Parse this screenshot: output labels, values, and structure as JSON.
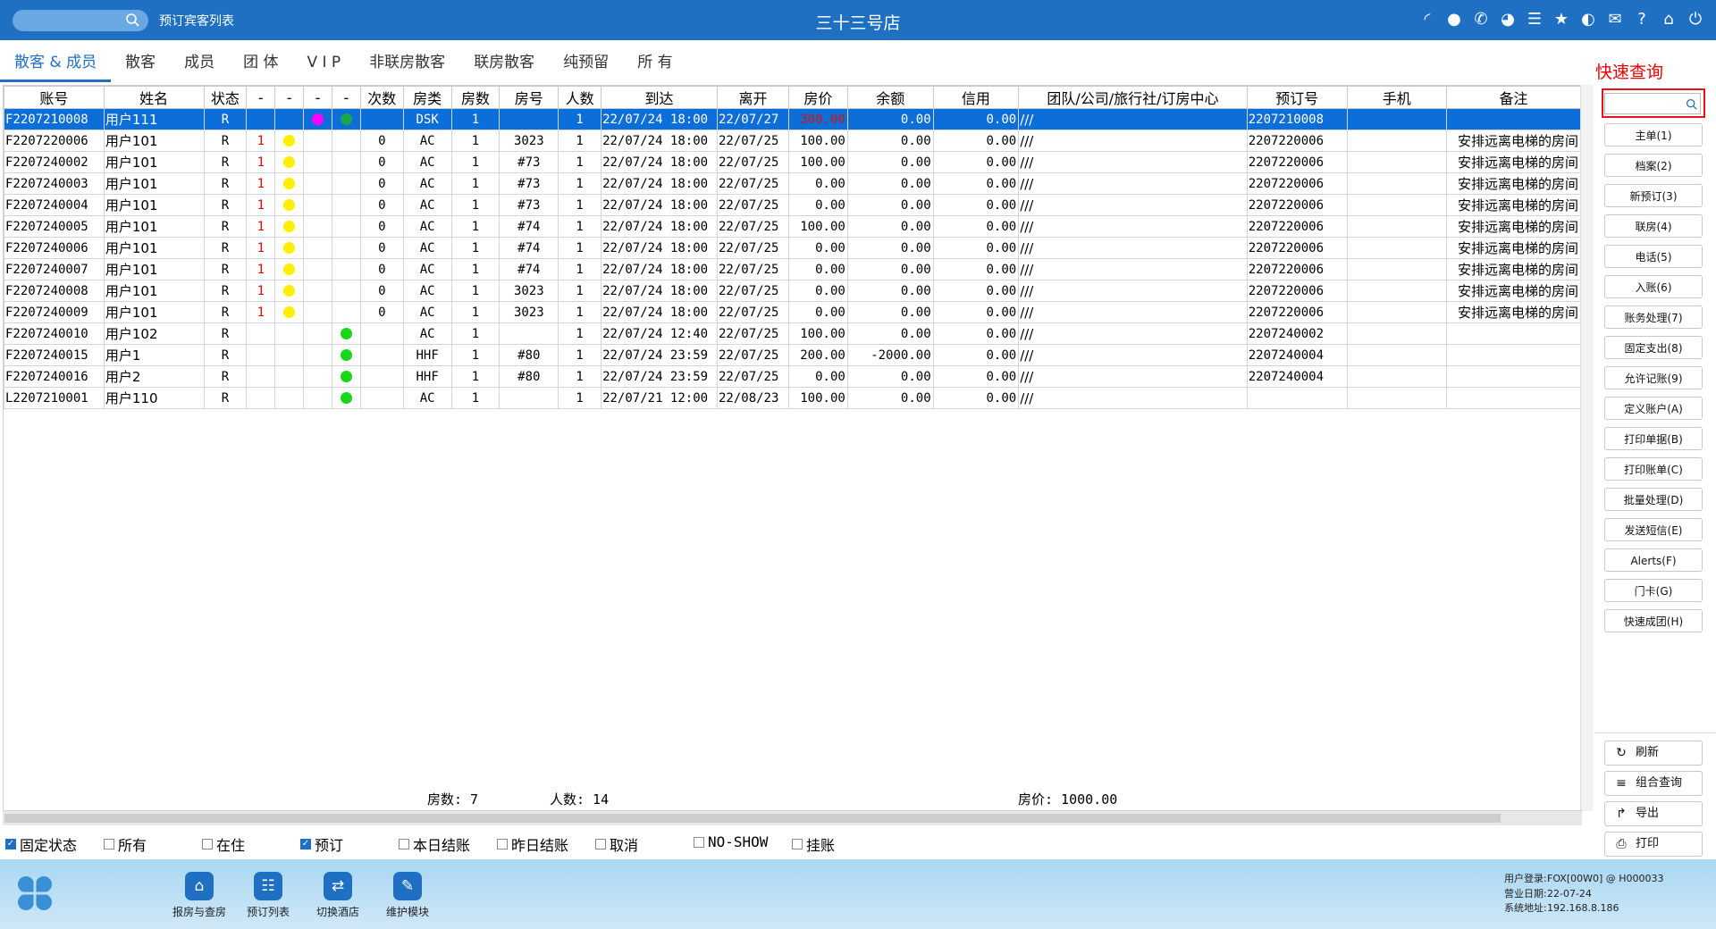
{
  "topbar": {
    "window_title": "预订宾客列表",
    "store_name": "三十三号店",
    "icons": [
      "wifi-icon",
      "message-icon",
      "phone-icon",
      "palette-icon",
      "menu-icon",
      "star-icon",
      "theme-icon",
      "mail-icon",
      "help-icon",
      "home-icon",
      "power-icon"
    ]
  },
  "tabs": [
    "散客 & 成员",
    "散客",
    "成员",
    "团 体",
    "V I P",
    "非联房散客",
    "联房散客",
    "纯预留",
    "所 有"
  ],
  "table": {
    "headers": [
      "账号",
      "姓名",
      "状态",
      "-",
      "-",
      "-",
      "-",
      "次数",
      "房类",
      "房数",
      "房号",
      "人数",
      "到达",
      "离开",
      "房价",
      "余额",
      "信用",
      "团队/公司/旅行社/订房中心",
      "预订号",
      "手机",
      "备注"
    ],
    "rows": [
      [
        "F2207210008",
        "用户111",
        "R",
        "",
        "",
        "magenta",
        "green",
        "",
        "DSK",
        "1",
        "",
        "1",
        "22/07/24 18:00",
        "22/07/27",
        "300.00",
        "0.00",
        "0.00",
        "///",
        "2207210008",
        "",
        ""
      ],
      [
        "F2207220006",
        "用户101",
        "R",
        "1",
        "yellow",
        "",
        "",
        "0",
        "AC",
        "1",
        "3023",
        "1",
        "22/07/24 18:00",
        "22/07/25",
        "100.00",
        "0.00",
        "0.00",
        "///",
        "2207220006",
        "",
        "安排远离电梯的房间"
      ],
      [
        "F2207240002",
        "用户101",
        "R",
        "1",
        "yellow",
        "",
        "",
        "0",
        "AC",
        "1",
        "#73",
        "1",
        "22/07/24 18:00",
        "22/07/25",
        "100.00",
        "0.00",
        "0.00",
        "///",
        "2207220006",
        "",
        "安排远离电梯的房间"
      ],
      [
        "F2207240003",
        "用户101",
        "R",
        "1",
        "yellow",
        "",
        "",
        "0",
        "AC",
        "1",
        "#73",
        "1",
        "22/07/24 18:00",
        "22/07/25",
        "0.00",
        "0.00",
        "0.00",
        "///",
        "2207220006",
        "",
        "安排远离电梯的房间"
      ],
      [
        "F2207240004",
        "用户101",
        "R",
        "1",
        "yellow",
        "",
        "",
        "0",
        "AC",
        "1",
        "#73",
        "1",
        "22/07/24 18:00",
        "22/07/25",
        "0.00",
        "0.00",
        "0.00",
        "///",
        "2207220006",
        "",
        "安排远离电梯的房间"
      ],
      [
        "F2207240005",
        "用户101",
        "R",
        "1",
        "yellow",
        "",
        "",
        "0",
        "AC",
        "1",
        "#74",
        "1",
        "22/07/24 18:00",
        "22/07/25",
        "100.00",
        "0.00",
        "0.00",
        "///",
        "2207220006",
        "",
        "安排远离电梯的房间"
      ],
      [
        "F2207240006",
        "用户101",
        "R",
        "1",
        "yellow",
        "",
        "",
        "0",
        "AC",
        "1",
        "#74",
        "1",
        "22/07/24 18:00",
        "22/07/25",
        "0.00",
        "0.00",
        "0.00",
        "///",
        "2207220006",
        "",
        "安排远离电梯的房间"
      ],
      [
        "F2207240007",
        "用户101",
        "R",
        "1",
        "yellow",
        "",
        "",
        "0",
        "AC",
        "1",
        "#74",
        "1",
        "22/07/24 18:00",
        "22/07/25",
        "0.00",
        "0.00",
        "0.00",
        "///",
        "2207220006",
        "",
        "安排远离电梯的房间"
      ],
      [
        "F2207240008",
        "用户101",
        "R",
        "1",
        "yellow",
        "",
        "",
        "0",
        "AC",
        "1",
        "3023",
        "1",
        "22/07/24 18:00",
        "22/07/25",
        "0.00",
        "0.00",
        "0.00",
        "///",
        "2207220006",
        "",
        "安排远离电梯的房间"
      ],
      [
        "F2207240009",
        "用户101",
        "R",
        "1",
        "yellow",
        "",
        "",
        "0",
        "AC",
        "1",
        "3023",
        "1",
        "22/07/24 18:00",
        "22/07/25",
        "0.00",
        "0.00",
        "0.00",
        "///",
        "2207220006",
        "",
        "安排远离电梯的房间"
      ],
      [
        "F2207240010",
        "用户102",
        "R",
        "",
        "",
        "",
        "green",
        "",
        "AC",
        "1",
        "",
        "1",
        "22/07/24 12:40",
        "22/07/25",
        "100.00",
        "0.00",
        "0.00",
        "///",
        "2207240002",
        "",
        ""
      ],
      [
        "F2207240015",
        "用户1",
        "R",
        "",
        "",
        "",
        "green",
        "",
        "HHF",
        "1",
        "#80",
        "1",
        "22/07/24 23:59",
        "22/07/25",
        "200.00",
        "-2000.00",
        "0.00",
        "///",
        "2207240004",
        "",
        ""
      ],
      [
        "F2207240016",
        "用户2",
        "R",
        "",
        "",
        "",
        "green",
        "",
        "HHF",
        "1",
        "#80",
        "1",
        "22/07/24 23:59",
        "22/07/25",
        "0.00",
        "0.00",
        "0.00",
        "///",
        "2207240004",
        "",
        ""
      ],
      [
        "L2207210001",
        "用户110",
        "R",
        "",
        "",
        "",
        "green",
        "",
        "AC",
        "1",
        "",
        "1",
        "22/07/21 12:00",
        "22/08/23",
        "100.00",
        "0.00",
        "0.00",
        "///",
        "",
        "",
        ""
      ]
    ],
    "selected_row": 0
  },
  "summary": {
    "rooms": "房数: 7",
    "persons": "人数: 14",
    "rate": "房价: 1000.00"
  },
  "filters": [
    {
      "label": "固定状态",
      "checked": true
    },
    {
      "label": "所有",
      "checked": false
    },
    {
      "label": "在住",
      "checked": false
    },
    {
      "label": "预订",
      "checked": true
    },
    {
      "label": "本日结账",
      "checked": false
    },
    {
      "label": "昨日结账",
      "checked": false
    },
    {
      "label": "取消",
      "checked": false
    },
    {
      "label": "NO-SHOW",
      "checked": false
    },
    {
      "label": "挂账",
      "checked": false
    }
  ],
  "quick_search": {
    "label": "快速查询",
    "value": ""
  },
  "side_buttons": [
    "主单(1)",
    "档案(2)",
    "新预订(3)",
    "联房(4)",
    "电话(5)",
    "入账(6)",
    "账务处理(7)",
    "固定支出(8)",
    "允许记账(9)",
    "定义账户(A)",
    "打印单据(B)",
    "打印账单(C)",
    "批量处理(D)",
    "发送短信(E)",
    "Alerts(F)",
    "门卡(G)",
    "快速成团(H)"
  ],
  "side_bottom": [
    {
      "label": "刷新",
      "icon": "refresh-icon"
    },
    {
      "label": "组合查询",
      "icon": "list-icon"
    },
    {
      "label": "导出",
      "icon": "export-icon"
    },
    {
      "label": "打印",
      "icon": "print-icon"
    }
  ],
  "bottom_modules": [
    {
      "label": "报房与查房",
      "icon": "house-search-icon"
    },
    {
      "label": "预订列表",
      "icon": "reservation-list-icon"
    },
    {
      "label": "切换酒店",
      "icon": "switch-icon"
    },
    {
      "label": "维护模块",
      "icon": "wrench-icon"
    }
  ],
  "sysinfo": [
    {
      "key": "用户登录:",
      "value": "FOX[00W0] @ H000033"
    },
    {
      "key": "营业日期:",
      "value": "22-07-24"
    },
    {
      "key": "系统地址:",
      "value": "192.168.8.186"
    }
  ],
  "colors": {
    "brand": "#1f6fc2",
    "selected_row": "#0b6ed9",
    "highlight_red": "#e60000",
    "yellow": "#ffee00",
    "green": "#19d619",
    "magenta": "#ff00ff"
  }
}
